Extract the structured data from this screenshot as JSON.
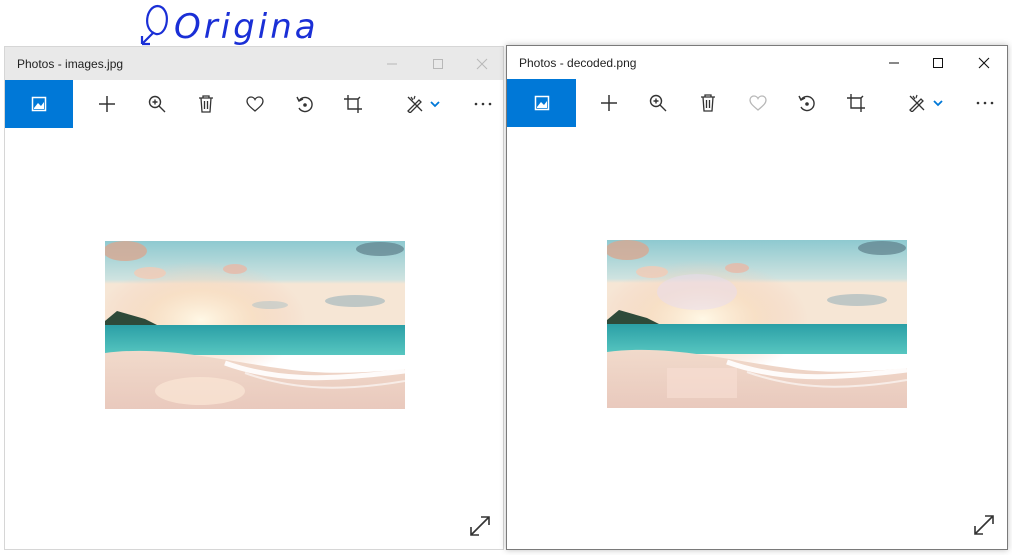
{
  "annotation": {
    "text": "Original",
    "color": "#1a2fd6"
  },
  "windows": [
    {
      "id": "left",
      "title": "Photos - images.jpg",
      "active": false,
      "toolbar_icons": [
        "view-photo-icon",
        "add-icon",
        "zoom-icon",
        "delete-icon",
        "favorite-icon",
        "rotate-icon",
        "crop-icon",
        "edit-create-icon",
        "chevron-down-icon",
        "more-icon"
      ],
      "image": {
        "variant": "original",
        "description_icon": "beach-sunset-photo"
      }
    },
    {
      "id": "right",
      "title": "Photos - decoded.png",
      "active": true,
      "toolbar_icons": [
        "view-photo-icon",
        "add-icon",
        "zoom-icon",
        "delete-icon",
        "favorite-icon",
        "rotate-icon",
        "crop-icon",
        "edit-create-icon",
        "chevron-down-icon",
        "more-icon"
      ],
      "image": {
        "variant": "decoded",
        "description_icon": "beach-sunset-photo"
      }
    }
  ],
  "colors": {
    "accent": "#0078d7",
    "inactive_titlebar": "#e9e9e9",
    "icon": "#333333"
  }
}
